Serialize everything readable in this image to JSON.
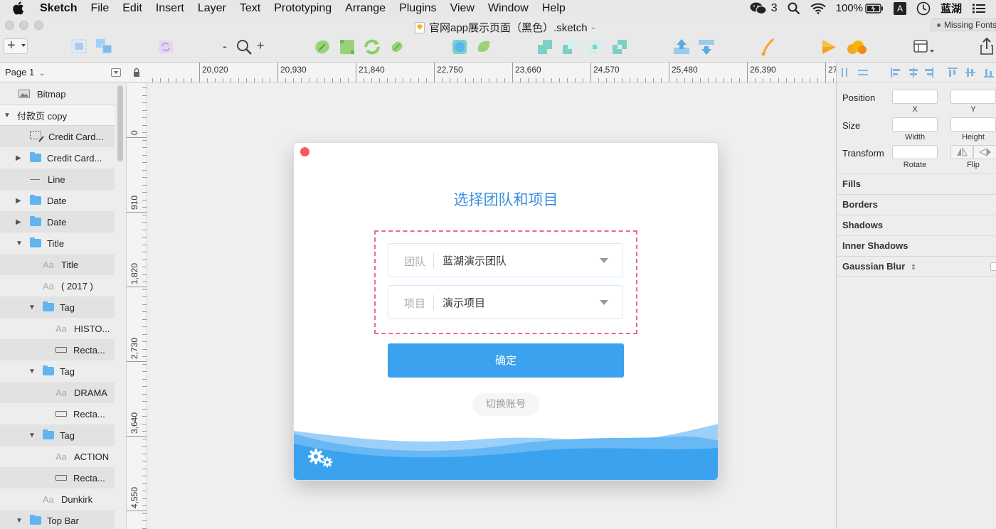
{
  "menubar": {
    "app_name": "Sketch",
    "items": [
      "File",
      "Edit",
      "Insert",
      "Layer",
      "Text",
      "Prototyping",
      "Arrange",
      "Plugins",
      "View",
      "Window",
      "Help"
    ],
    "wechat_count": "3",
    "battery": "100%",
    "input_method": "A",
    "user": "蓝湖"
  },
  "window": {
    "title": "官网app展示页面（黑色）.sketch",
    "missing_fonts": "Missing Fonts"
  },
  "toolbar": {
    "zoom_minus": "-",
    "zoom_plus": "+"
  },
  "page_selector": {
    "label": "Page 1"
  },
  "hruler": {
    "labels": [
      "20,020",
      "20,930",
      "21,840",
      "22,750",
      "23,660",
      "24,570",
      "25,480",
      "26,390",
      "27"
    ]
  },
  "vruler": {
    "labels": [
      "0",
      "910",
      "1,820",
      "2,730",
      "3,640",
      "4,550"
    ]
  },
  "layers": [
    {
      "name": "Bitmap",
      "icon": "bitmap-icon"
    },
    {
      "name": "付款页 copy",
      "icon": "artboard"
    },
    {
      "name": "Credit Card...",
      "icon": "dashed-shape-icon"
    },
    {
      "name": "Credit Card...",
      "icon": "folder-icon"
    },
    {
      "name": "Line",
      "icon": "line-icon"
    },
    {
      "name": "Date",
      "icon": "folder-icon"
    },
    {
      "name": "Date",
      "icon": "folder-icon"
    },
    {
      "name": "Title",
      "icon": "folder-icon"
    },
    {
      "name": "Title",
      "icon": "text-icon"
    },
    {
      "name": "( 2017 )",
      "icon": "text-icon"
    },
    {
      "name": "Tag",
      "icon": "folder-icon"
    },
    {
      "name": "HISTO...",
      "icon": "text-icon"
    },
    {
      "name": "Recta...",
      "icon": "rectangle-icon"
    },
    {
      "name": "Tag",
      "icon": "folder-icon"
    },
    {
      "name": "DRAMA",
      "icon": "text-icon"
    },
    {
      "name": "Recta...",
      "icon": "rectangle-icon"
    },
    {
      "name": "Tag",
      "icon": "folder-icon"
    },
    {
      "name": "ACTION",
      "icon": "text-icon"
    },
    {
      "name": "Recta...",
      "icon": "rectangle-icon"
    },
    {
      "name": "Dunkirk",
      "icon": "text-icon"
    },
    {
      "name": "Top Bar",
      "icon": "folder-icon"
    }
  ],
  "artboard": {
    "title": "选择团队和项目",
    "team_label": "团队",
    "team_value": "蓝湖演示团队",
    "project_label": "项目",
    "project_value": "演示项目",
    "confirm": "确定",
    "switch_account": "切换账号",
    "colors": {
      "accent": "#3aa2ee",
      "title": "#3a8fde",
      "dash": "#f06a83",
      "arrow": "#f45b78"
    }
  },
  "inspector": {
    "position": "Position",
    "x": "X",
    "y": "Y",
    "size": "Size",
    "width": "Width",
    "height": "Height",
    "transform": "Transform",
    "rotate": "Rotate",
    "flip": "Flip",
    "sections": [
      "Fills",
      "Borders",
      "Shadows",
      "Inner Shadows",
      "Gaussian Blur"
    ]
  }
}
